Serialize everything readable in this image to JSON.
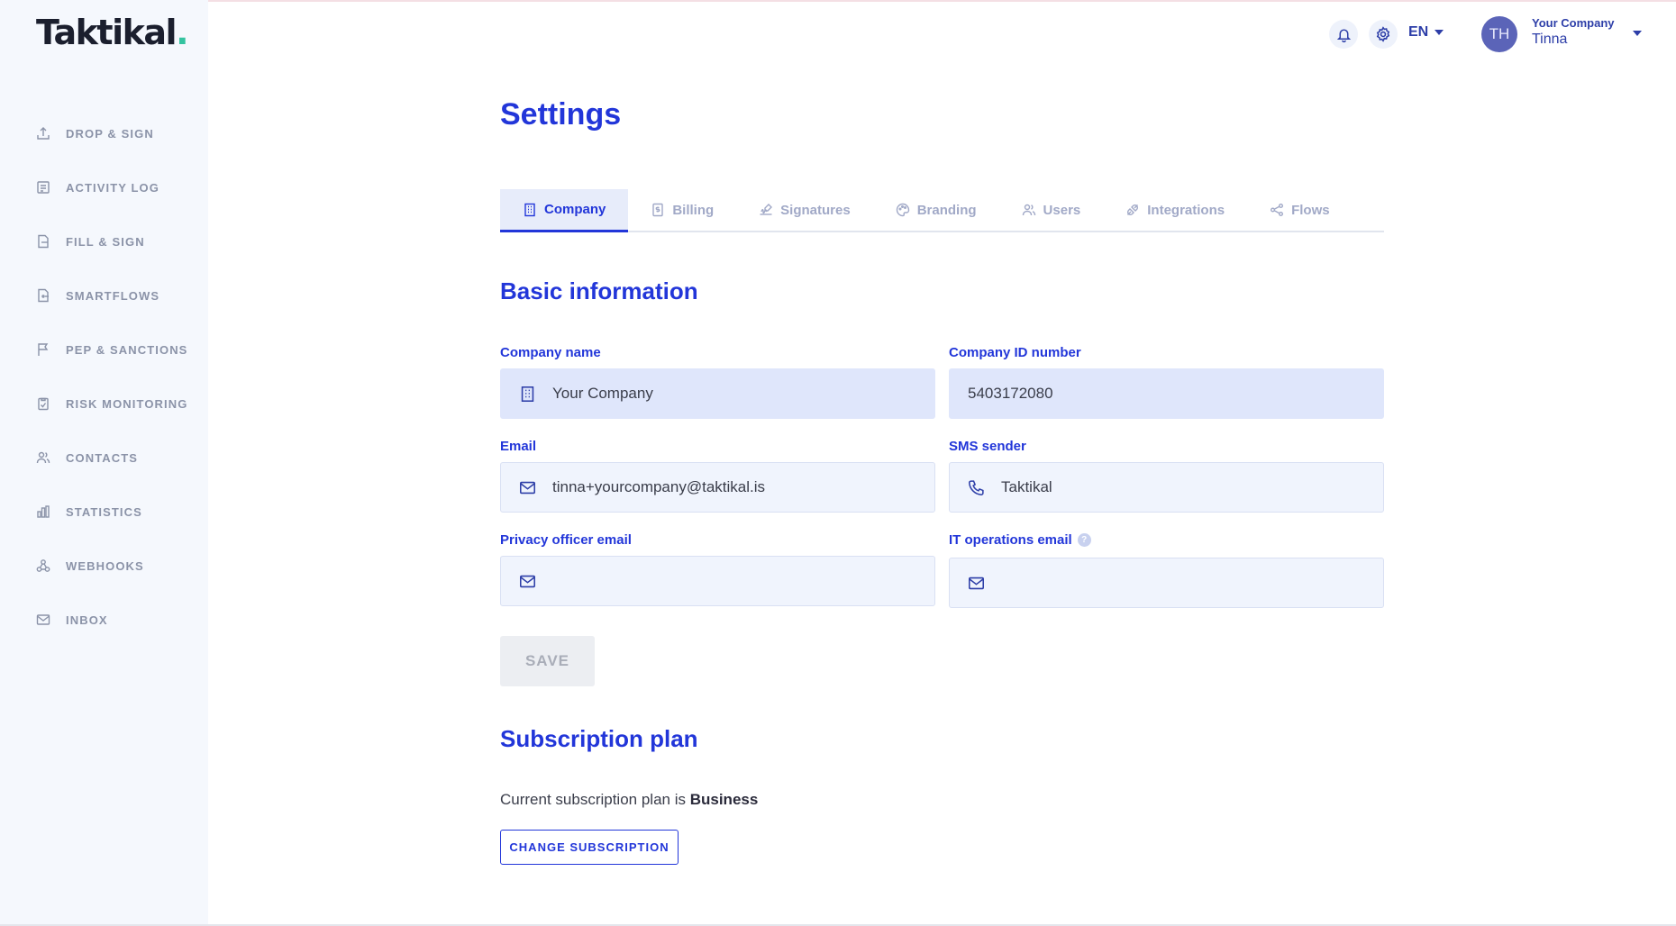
{
  "brand": {
    "name": "Taktikal",
    "dot": "."
  },
  "sidebar": {
    "items": [
      {
        "label": "DROP & SIGN",
        "icon": "upload-icon"
      },
      {
        "label": "ACTIVITY LOG",
        "icon": "list-icon"
      },
      {
        "label": "FILL & SIGN",
        "icon": "document-edit-icon"
      },
      {
        "label": "SMARTFLOWS",
        "icon": "document-flow-icon"
      },
      {
        "label": "PEP & SANCTIONS",
        "icon": "flag-icon"
      },
      {
        "label": "RISK MONITORING",
        "icon": "clipboard-check-icon"
      },
      {
        "label": "CONTACTS",
        "icon": "users-icon"
      },
      {
        "label": "STATISTICS",
        "icon": "bar-chart-icon"
      },
      {
        "label": "WEBHOOKS",
        "icon": "webhook-icon"
      },
      {
        "label": "INBOX",
        "icon": "mail-icon"
      }
    ]
  },
  "topbar": {
    "language": "EN",
    "avatar_initials": "TH",
    "user_company": "Your Company",
    "user_name": "Tinna"
  },
  "page": {
    "title": "Settings"
  },
  "tabs": [
    {
      "label": "Company",
      "icon": "building-icon",
      "active": true
    },
    {
      "label": "Billing",
      "icon": "invoice-icon",
      "active": false
    },
    {
      "label": "Signatures",
      "icon": "signature-icon",
      "active": false
    },
    {
      "label": "Branding",
      "icon": "palette-icon",
      "active": false
    },
    {
      "label": "Users",
      "icon": "users-icon",
      "active": false
    },
    {
      "label": "Integrations",
      "icon": "plug-icon",
      "active": false
    },
    {
      "label": "Flows",
      "icon": "share-icon",
      "active": false
    }
  ],
  "basic_info": {
    "title": "Basic information",
    "company_name": {
      "label": "Company name",
      "value": "Your Company"
    },
    "company_id": {
      "label": "Company ID number",
      "value": "5403172080"
    },
    "email": {
      "label": "Email",
      "value": "tinna+yourcompany@taktikal.is"
    },
    "sms_sender": {
      "label": "SMS sender",
      "value": "Taktikal"
    },
    "privacy_email": {
      "label": "Privacy officer email",
      "value": ""
    },
    "it_email": {
      "label": "IT operations email",
      "value": "",
      "help": "?"
    },
    "save_label": "SAVE"
  },
  "subscription": {
    "title": "Subscription plan",
    "text": "Current subscription plan is",
    "plan": "Business",
    "change_label": "CHANGE SUBSCRIPTION"
  },
  "colors": {
    "accent": "#2236d9",
    "sidebar_bg": "#f5f8fd",
    "logo_dot": "#34c3a0"
  }
}
